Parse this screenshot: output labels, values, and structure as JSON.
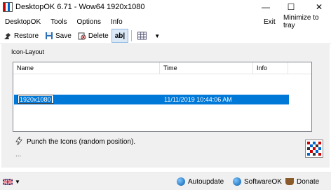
{
  "window": {
    "title": "DesktopOK 6.71 - Wow64 1920x1080",
    "minimize_icon": "—",
    "maximize_icon": "☐",
    "close_icon": "✕"
  },
  "menu": {
    "items": [
      "DesktopOK",
      "Tools",
      "Options",
      "Info"
    ],
    "exit": "Exit",
    "minimize_to_tray": "Minimize to tray"
  },
  "toolbar": {
    "restore": "Restore",
    "save": "Save",
    "delete": "Delete",
    "rename": "ab|"
  },
  "group": {
    "label": "Icon-Layout"
  },
  "table": {
    "columns": [
      "Name",
      "Time",
      "Info"
    ],
    "rows": [
      {
        "name": "1920x1080",
        "time": "11/11/2019 10:44:06 AM",
        "info": ""
      }
    ]
  },
  "status": {
    "message": "Punch the Icons (random position).",
    "dots": "..."
  },
  "bottom": {
    "autoupdate": "Autoupdate",
    "softwareok": "SoftwareOK",
    "donate": "Donate",
    "lang_arrow": "▼"
  },
  "colors": {
    "selection": "#0078d7",
    "panel": "#f0f0f0"
  }
}
